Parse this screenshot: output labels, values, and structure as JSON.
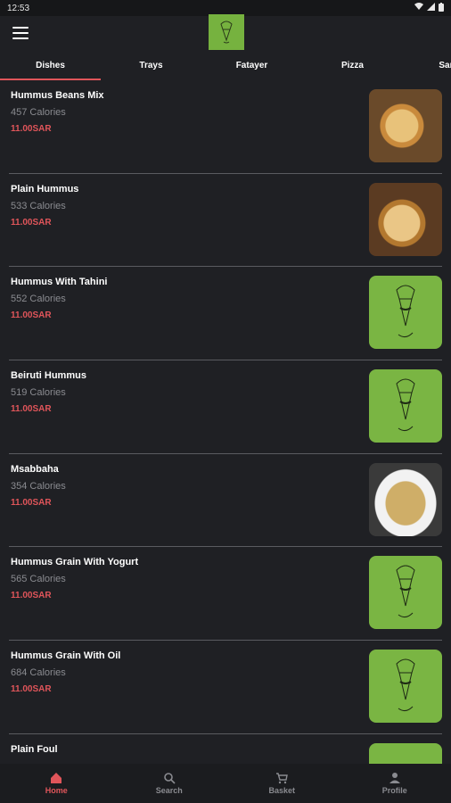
{
  "status": {
    "time": "12:53"
  },
  "tabs": [
    {
      "label": "Dishes",
      "active": true
    },
    {
      "label": "Trays"
    },
    {
      "label": "Fatayer"
    },
    {
      "label": "Pizza"
    },
    {
      "label": "Sandw"
    }
  ],
  "items": [
    {
      "name": "Hummus Beans Mix",
      "calories": "457 Calories",
      "price": "11.00SAR",
      "image": "photo"
    },
    {
      "name": "Plain Hummus",
      "calories": "533 Calories",
      "price": "11.00SAR",
      "image": "photo"
    },
    {
      "name": "Hummus With Tahini",
      "calories": "552 Calories",
      "price": "11.00SAR",
      "image": "placeholder"
    },
    {
      "name": "Beiruti Hummus",
      "calories": "519 Calories",
      "price": "11.00SAR",
      "image": "placeholder"
    },
    {
      "name": "Msabbaha",
      "calories": "354 Calories",
      "price": "11.00SAR",
      "image": "photo"
    },
    {
      "name": "Hummus Grain With Yogurt",
      "calories": "565 Calories",
      "price": "11.00SAR",
      "image": "placeholder"
    },
    {
      "name": "Hummus Grain With Oil",
      "calories": "684 Calories",
      "price": "11.00SAR",
      "image": "placeholder"
    },
    {
      "name": "Plain Foul",
      "calories": "",
      "price": "",
      "image": "placeholder"
    }
  ],
  "nav": [
    {
      "label": "Home",
      "icon": "home-icon",
      "active": true
    },
    {
      "label": "Search",
      "icon": "search-icon"
    },
    {
      "label": "Basket",
      "icon": "basket-icon"
    },
    {
      "label": "Profile",
      "icon": "profile-icon"
    }
  ],
  "colors": {
    "accent": "#e0555a",
    "brand_green": "#76b23f",
    "background": "#1f2024"
  }
}
